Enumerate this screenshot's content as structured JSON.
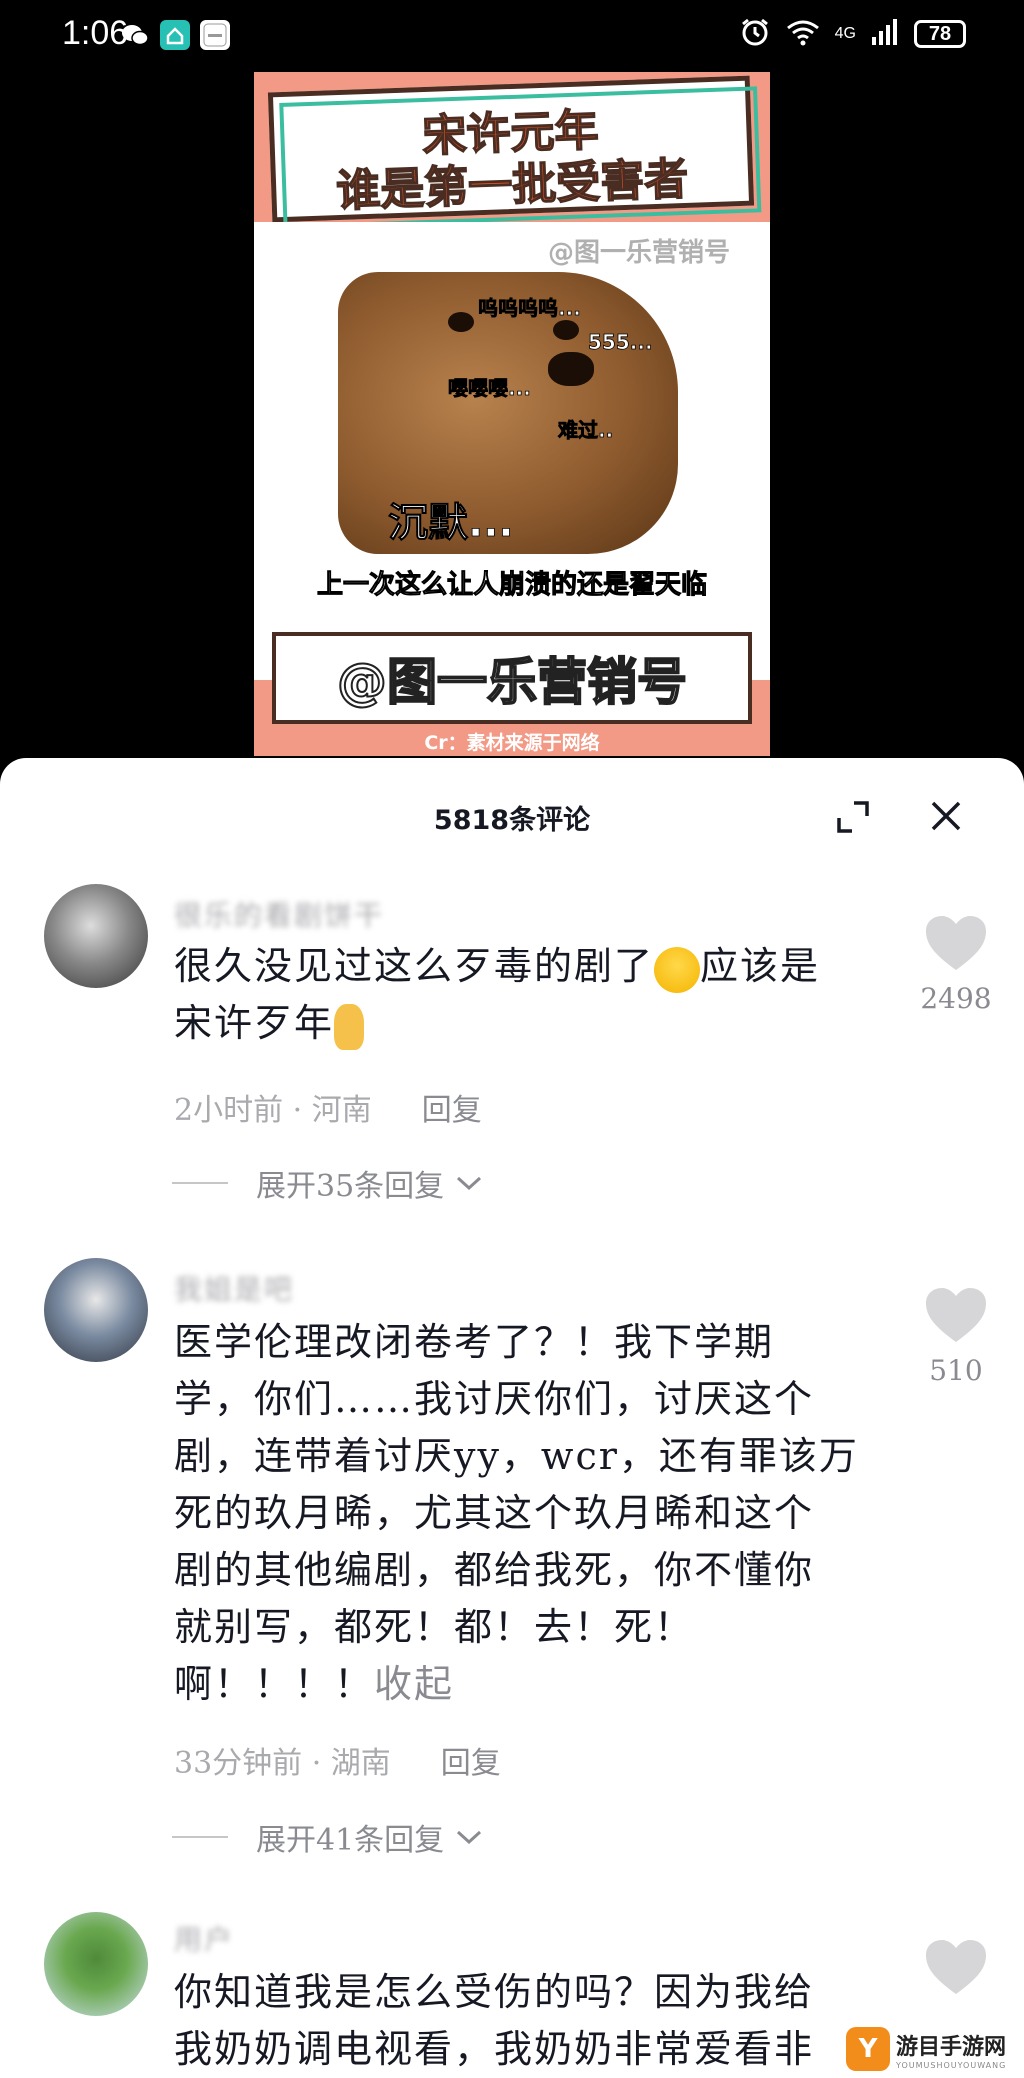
{
  "status_bar": {
    "time": "1:06",
    "network": "4G",
    "battery": "78"
  },
  "video": {
    "title_line1": "宋许元年",
    "title_line2": "谁是第一批受害者",
    "watermark": "@图一乐营销号",
    "dog_labels": [
      "呜呜呜呜...",
      "555...",
      "嘤嘤嘤...",
      "难过..",
      "沉默..."
    ],
    "caption": "上一次这么让人崩溃的还是翟天临",
    "handle": "@图一乐营销号",
    "source": "Cr：素材来源于网络"
  },
  "comments_panel": {
    "title": "5818条评论",
    "comments": [
      {
        "name": "很乐的看剧饼干",
        "text_line1": "很久没见过这么歹毒的剧了",
        "text_line1b": "应该是",
        "text_line2": "宋许歹年",
        "time_location": "2小时前 · 河南",
        "reply": "回复",
        "expand": "展开35条回复",
        "likes": "2498"
      },
      {
        "name": "我姐是吧",
        "lines": [
          "医学伦理改闭卷考了？！我下学期",
          "学，你们……我讨厌你们，讨厌这个",
          "剧，连带着讨厌yy，wcr，还有罪该万",
          "死的玖月晞，尤其这个玖月晞和这个",
          "剧的其他编剧，都给我死，你不懂你",
          "就别写，都死！都！去！死！"
        ],
        "last_line": "啊！！！！",
        "fold": "收起",
        "time_location": "33分钟前 · 湖南",
        "reply": "回复",
        "expand": "展开41条回复",
        "likes": "510"
      },
      {
        "name": "用户",
        "line1": "你知道我是怎么受伤的吗？因为我给",
        "line2": "我奶奶调电视看，我奶奶非常爱看非"
      }
    ]
  },
  "logo": {
    "mark": "Y",
    "text": "游目手游网",
    "sub": "YOUMUSHOUYOUWANG"
  },
  "colors": {
    "video_bg": "#f39a86",
    "title_orange": "#ff5722",
    "accent_teal": "#3bbe9f",
    "text_main": "#161823",
    "text_muted": "#8a8b91"
  }
}
